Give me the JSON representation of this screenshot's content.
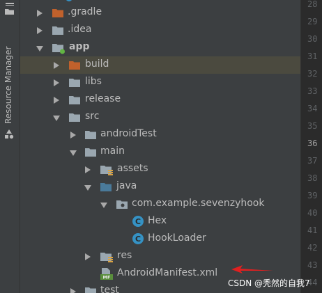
{
  "side_panel": {
    "label": "Resource Manager"
  },
  "tree": {
    "items": [
      {
        "label": ".gradle",
        "icon": "folder-orange-icon",
        "expanded": false
      },
      {
        "label": ".idea",
        "icon": "folder-icon",
        "expanded": false
      },
      {
        "label": "app",
        "icon": "module-folder-icon",
        "expanded": true
      },
      {
        "label": "build",
        "icon": "folder-orange-icon",
        "expanded": false
      },
      {
        "label": "libs",
        "icon": "folder-icon",
        "expanded": false
      },
      {
        "label": "release",
        "icon": "folder-icon",
        "expanded": false
      },
      {
        "label": "src",
        "icon": "folder-icon",
        "expanded": true
      },
      {
        "label": "androidTest",
        "icon": "folder-icon",
        "expanded": false
      },
      {
        "label": "main",
        "icon": "folder-icon",
        "expanded": true
      },
      {
        "label": "assets",
        "icon": "resource-folder-icon",
        "expanded": false
      },
      {
        "label": "java",
        "icon": "source-folder-icon",
        "expanded": true
      },
      {
        "label": "com.example.sevenzyhook",
        "icon": "package-icon",
        "expanded": true
      },
      {
        "label": "Hex",
        "icon": "class-icon"
      },
      {
        "label": "HookLoader",
        "icon": "class-icon"
      },
      {
        "label": "res",
        "icon": "resource-folder-icon",
        "expanded": false
      },
      {
        "label": "AndroidManifest.xml",
        "icon": "manifest-file-icon"
      },
      {
        "label": "test",
        "icon": "folder-icon",
        "expanded": false
      }
    ],
    "highlight_color": "#4b4a3f"
  },
  "gutter": {
    "lines": [
      "28",
      "29",
      "30",
      "31",
      "32",
      "33",
      "34",
      "35",
      "36",
      "37",
      "38",
      "39",
      "40",
      "41",
      "42",
      "43",
      "44"
    ],
    "current": "36"
  },
  "watermark": "CSDN @秃然的自我7",
  "colors": {
    "background": "#3c3f41",
    "folder": "#9aa7b0",
    "folder_orange": "#c0612c",
    "source_folder": "#4a7a9a",
    "class_badge": "#3592c4",
    "module_dot": "#62b543",
    "annotation_arrow": "#e02020"
  }
}
